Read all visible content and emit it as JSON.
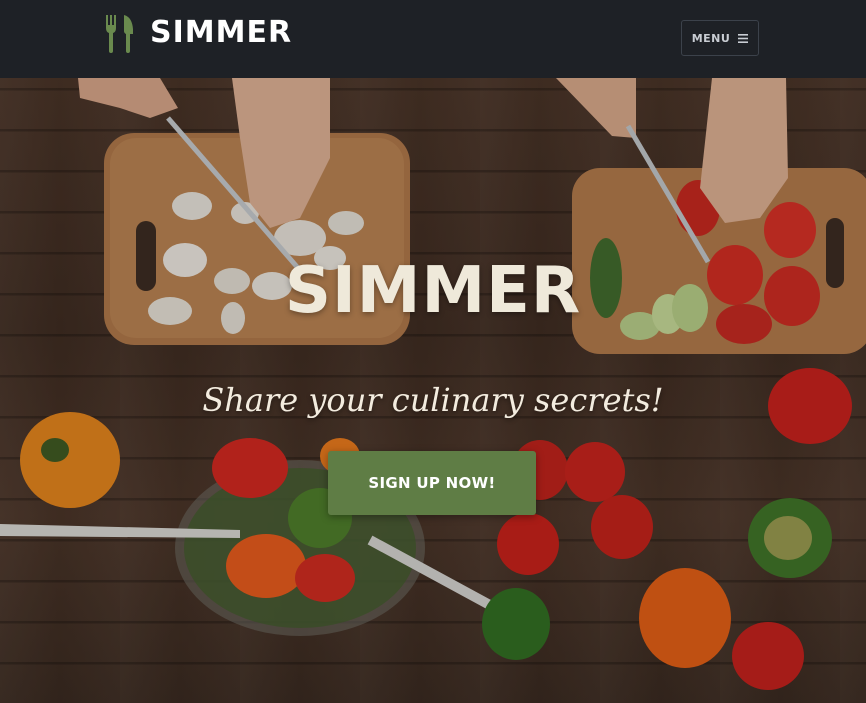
{
  "header": {
    "brand_name": "SIMMER",
    "brand_icon": "fork-knife-icon",
    "menu_label": "MENU",
    "menu_icon": "hamburger-icon"
  },
  "hero": {
    "title": "SIMMER",
    "tagline": "Share your culinary secrets!",
    "cta_label": "SIGN UP NOW!"
  },
  "colors": {
    "header_bg": "#1e2126",
    "brand_accent": "#6a8a4e",
    "cta_bg": "#5f7d45",
    "title_text": "#efe9da"
  }
}
